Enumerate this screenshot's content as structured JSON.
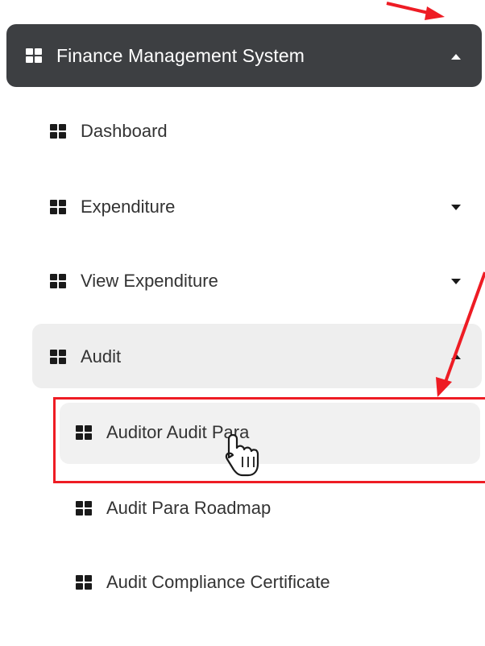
{
  "sidebar": {
    "header": {
      "label": "Finance Management System",
      "icon": "grid-icon",
      "state": "expanded"
    },
    "items": [
      {
        "label": "Dashboard",
        "icon": "grid-icon"
      },
      {
        "label": "Expenditure",
        "icon": "grid-icon",
        "state": "collapsed"
      },
      {
        "label": "View Expenditure",
        "icon": "grid-icon",
        "state": "collapsed"
      },
      {
        "label": "Audit",
        "icon": "grid-icon",
        "state": "expanded"
      }
    ],
    "audit_children": [
      {
        "label": "Auditor Audit Para",
        "icon": "grid-icon",
        "state": "hovered"
      },
      {
        "label": "Audit Para Roadmap",
        "icon": "grid-icon"
      },
      {
        "label": "Audit Compliance Certificate",
        "icon": "grid-icon"
      }
    ]
  },
  "annotation": {
    "color": "#ee1c24"
  },
  "colors": {
    "header_bg": "#3d3f42",
    "active_bg": "#eeeeee",
    "text": "#333333"
  }
}
